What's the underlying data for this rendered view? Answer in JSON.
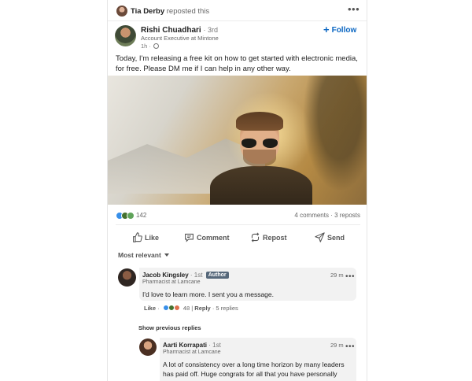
{
  "repost": {
    "name": "Tia Derby",
    "action": "reposted this"
  },
  "post": {
    "author_name": "Rishi Chuadhari",
    "author_degree": "· 3rd",
    "author_title": "Account Executive at Mintone",
    "time": "1h ·",
    "follow_label": "Follow",
    "text": "Today, I'm releasing a free kit on how to get started with electronic media, for free. Please DM me if I can help in any other way.",
    "reaction_count": "142",
    "stats": "4 comments · 3 reposts"
  },
  "actions": {
    "like": "Like",
    "comment": "Comment",
    "repost": "Repost",
    "send": "Send"
  },
  "sort_label": "Most relevant",
  "comments": [
    {
      "name": "Jacob Kingsley",
      "degree": "· 1st",
      "badge": "Author",
      "title": "Pharmacist at Lamcane",
      "time": "29 m",
      "text": "I'd love to learn more. I sent you a message.",
      "like_label": "Like",
      "reaction_count": "48",
      "reply_label": "Reply",
      "replies": "· 5 replies"
    }
  ],
  "show_previous": "Show previous replies",
  "reply": {
    "name": "Aarti Korrapati",
    "degree": "· 1st",
    "title": "Pharmacist at Lamcane",
    "time": "29 m",
    "text": "A lot of consistency over a long time horizon by many leaders has paid off. Huge congrats for all that you have personally contributed to this!"
  },
  "colors": {
    "accent": "#0a66c2",
    "badge": "#56687a",
    "like_reaction": "#378fe9",
    "celebrate_reaction": "#44712e",
    "love_reaction": "#df704d"
  },
  "icons": [
    "more-icon",
    "globe-icon",
    "plus-icon",
    "like-icon",
    "comment-icon",
    "repost-icon",
    "send-icon",
    "caret-down-icon"
  ]
}
